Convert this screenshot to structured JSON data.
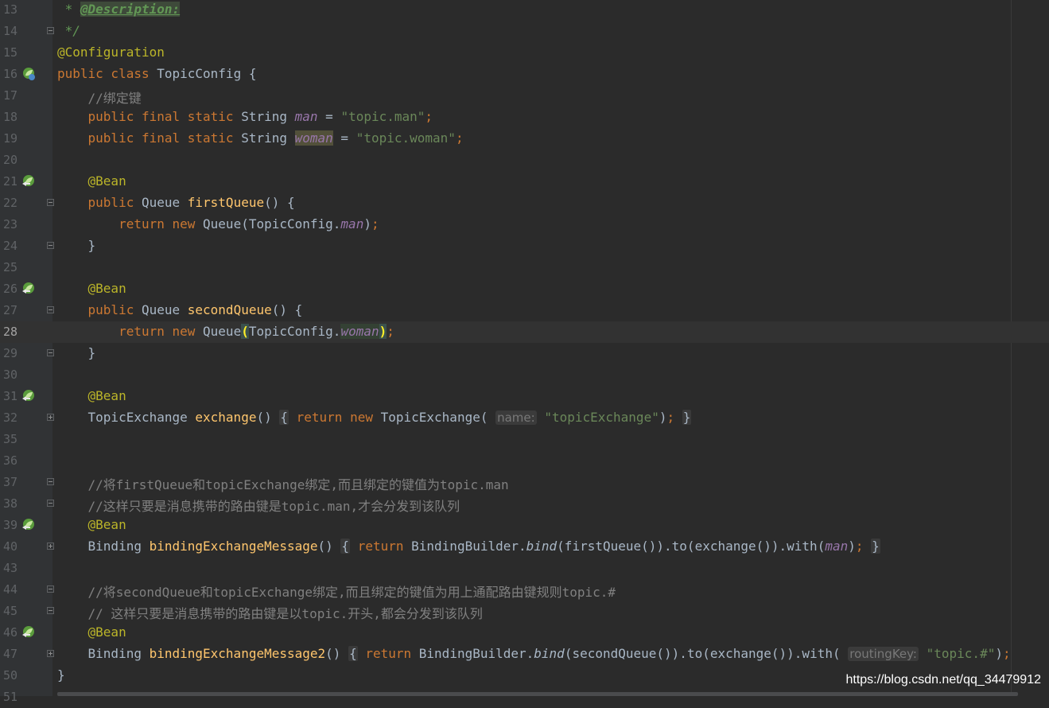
{
  "editor": {
    "current_line": "28",
    "watermark": "https://blog.csdn.net/qq_34479912",
    "lines": [
      {
        "no": "13",
        "t": [
          {
            "c": "doc",
            "s": " * "
          },
          {
            "c": "doctag",
            "s": "@Description:"
          }
        ]
      },
      {
        "no": "14",
        "t": [
          {
            "c": "doc",
            "s": " */"
          }
        ]
      },
      {
        "no": "15",
        "t": [
          {
            "c": "ann",
            "s": "@Configuration"
          }
        ]
      },
      {
        "no": "16",
        "t": [
          {
            "c": "kw",
            "s": "public class "
          },
          {
            "c": "",
            "s": "TopicConfig {"
          }
        ]
      },
      {
        "no": "17",
        "t": [
          {
            "c": "cm",
            "s": "    //绑定键"
          }
        ]
      },
      {
        "no": "18",
        "t": [
          {
            "c": "kw",
            "s": "    public final static "
          },
          {
            "c": "",
            "s": "String "
          },
          {
            "c": "sf",
            "s": "man"
          },
          {
            "c": "",
            "s": " = "
          },
          {
            "c": "str",
            "s": "\"topic.man\""
          },
          {
            "c": "kw",
            "s": ";"
          }
        ]
      },
      {
        "no": "19",
        "t": [
          {
            "c": "kw",
            "s": "    public final static "
          },
          {
            "c": "",
            "s": "String "
          },
          {
            "c": "sfh",
            "s": "woman"
          },
          {
            "c": "",
            "s": " = "
          },
          {
            "c": "str",
            "s": "\"topic.woman\""
          },
          {
            "c": "kw",
            "s": ";"
          }
        ]
      },
      {
        "no": "20",
        "t": []
      },
      {
        "no": "21",
        "t": [
          {
            "c": "ann",
            "s": "    @Bean"
          }
        ]
      },
      {
        "no": "22",
        "t": [
          {
            "c": "kw",
            "s": "    public "
          },
          {
            "c": "",
            "s": "Queue "
          },
          {
            "c": "fn",
            "s": "firstQueue"
          },
          {
            "c": "",
            "s": "() {"
          }
        ]
      },
      {
        "no": "23",
        "t": [
          {
            "c": "kw",
            "s": "        return new "
          },
          {
            "c": "",
            "s": "Queue(TopicConfig."
          },
          {
            "c": "sf",
            "s": "man"
          },
          {
            "c": "",
            "s": ")"
          },
          {
            "c": "kw",
            "s": ";"
          }
        ]
      },
      {
        "no": "24",
        "t": [
          {
            "c": "",
            "s": "    }"
          }
        ]
      },
      {
        "no": "25",
        "t": []
      },
      {
        "no": "26",
        "t": [
          {
            "c": "ann",
            "s": "    @Bean"
          }
        ]
      },
      {
        "no": "27",
        "t": [
          {
            "c": "kw",
            "s": "    public "
          },
          {
            "c": "",
            "s": "Queue "
          },
          {
            "c": "fn",
            "s": "secondQueue"
          },
          {
            "c": "",
            "s": "() {"
          }
        ]
      },
      {
        "no": "28",
        "t": [
          {
            "c": "kw",
            "s": "        return new "
          },
          {
            "c": "",
            "s": "Queue"
          },
          {
            "c": "brace",
            "s": "("
          },
          {
            "c": "",
            "s": "TopicConfig."
          },
          {
            "c": "sfu",
            "s": "woman"
          },
          {
            "c": "brace",
            "s": ")"
          },
          {
            "c": "kw",
            "s": ";"
          }
        ]
      },
      {
        "no": "29",
        "t": [
          {
            "c": "",
            "s": "    }"
          }
        ]
      },
      {
        "no": "30",
        "t": []
      },
      {
        "no": "31",
        "t": [
          {
            "c": "ann",
            "s": "    @Bean"
          }
        ]
      },
      {
        "no": "32",
        "t": [
          {
            "c": "",
            "s": "    TopicExchange "
          },
          {
            "c": "fn",
            "s": "exchange"
          },
          {
            "c": "",
            "s": "() "
          },
          {
            "c": "fbox",
            "s": "{"
          },
          {
            "c": "",
            "s": " "
          },
          {
            "c": "kw",
            "s": "return new "
          },
          {
            "c": "",
            "s": "TopicExchange( "
          },
          {
            "c": "hint",
            "s": "name:"
          },
          {
            "c": "str",
            "s": " \"topicExchange\""
          },
          {
            "c": "",
            "s": ")"
          },
          {
            "c": "kw",
            "s": "; "
          },
          {
            "c": "fbox",
            "s": "}"
          }
        ]
      },
      {
        "no": "35",
        "t": []
      },
      {
        "no": "36",
        "t": []
      },
      {
        "no": "37",
        "t": [
          {
            "c": "cm",
            "s": "    //将firstQueue和topicExchange绑定,而且绑定的键值为topic.man"
          }
        ]
      },
      {
        "no": "38",
        "t": [
          {
            "c": "cm",
            "s": "    //这样只要是消息携带的路由键是topic.man,才会分发到该队列"
          }
        ]
      },
      {
        "no": "39",
        "t": [
          {
            "c": "ann",
            "s": "    @Bean"
          }
        ]
      },
      {
        "no": "40",
        "t": [
          {
            "c": "",
            "s": "    Binding "
          },
          {
            "c": "fn",
            "s": "bindingExchangeMessage"
          },
          {
            "c": "",
            "s": "() "
          },
          {
            "c": "fbox",
            "s": "{"
          },
          {
            "c": "",
            "s": " "
          },
          {
            "c": "kw",
            "s": "return "
          },
          {
            "c": "",
            "s": "BindingBuilder."
          },
          {
            "c": "it",
            "s": "bind"
          },
          {
            "c": "",
            "s": "(firstQueue()).to(exchange()).with("
          },
          {
            "c": "sf",
            "s": "man"
          },
          {
            "c": "",
            "s": ")"
          },
          {
            "c": "kw",
            "s": "; "
          },
          {
            "c": "fbox",
            "s": "}"
          }
        ]
      },
      {
        "no": "43",
        "t": []
      },
      {
        "no": "44",
        "t": [
          {
            "c": "cm",
            "s": "    //将secondQueue和topicExchange绑定,而且绑定的键值为用上通配路由键规则topic.#"
          }
        ]
      },
      {
        "no": "45",
        "t": [
          {
            "c": "cm",
            "s": "    // 这样只要是消息携带的路由键是以topic.开头,都会分发到该队列"
          }
        ]
      },
      {
        "no": "46",
        "t": [
          {
            "c": "ann",
            "s": "    @Bean"
          }
        ]
      },
      {
        "no": "47",
        "t": [
          {
            "c": "",
            "s": "    Binding "
          },
          {
            "c": "fn",
            "s": "bindingExchangeMessage2"
          },
          {
            "c": "",
            "s": "() "
          },
          {
            "c": "fbox",
            "s": "{"
          },
          {
            "c": "",
            "s": " "
          },
          {
            "c": "kw",
            "s": "return "
          },
          {
            "c": "",
            "s": "BindingBuilder."
          },
          {
            "c": "it",
            "s": "bind"
          },
          {
            "c": "",
            "s": "(secondQueue()).to(exchange()).with( "
          },
          {
            "c": "hint",
            "s": "routingKey:"
          },
          {
            "c": "str",
            "s": " \"topic.#\""
          },
          {
            "c": "",
            "s": ")"
          },
          {
            "c": "kw",
            "s": ";"
          }
        ]
      },
      {
        "no": "50",
        "t": [
          {
            "c": "",
            "s": "}"
          }
        ]
      },
      {
        "no": "51",
        "t": []
      }
    ],
    "gutter_markers": [
      {
        "line": "16",
        "icon": "spring-config-icon"
      },
      {
        "line": "21",
        "icon": "spring-bean-icon"
      },
      {
        "line": "26",
        "icon": "spring-bean-icon"
      },
      {
        "line": "31",
        "icon": "spring-bean-icon"
      },
      {
        "line": "39",
        "icon": "spring-bean-icon"
      },
      {
        "line": "46",
        "icon": "spring-bean-icon"
      }
    ],
    "fold_markers": [
      {
        "line": "14",
        "type": "end"
      },
      {
        "line": "22",
        "type": "start"
      },
      {
        "line": "24",
        "type": "end"
      },
      {
        "line": "27",
        "type": "start"
      },
      {
        "line": "29",
        "type": "end"
      },
      {
        "line": "32",
        "type": "plus"
      },
      {
        "line": "37",
        "type": "start"
      },
      {
        "line": "38",
        "type": "end"
      },
      {
        "line": "40",
        "type": "plus"
      },
      {
        "line": "44",
        "type": "start"
      },
      {
        "line": "45",
        "type": "end"
      },
      {
        "line": "47",
        "type": "plus"
      }
    ]
  }
}
